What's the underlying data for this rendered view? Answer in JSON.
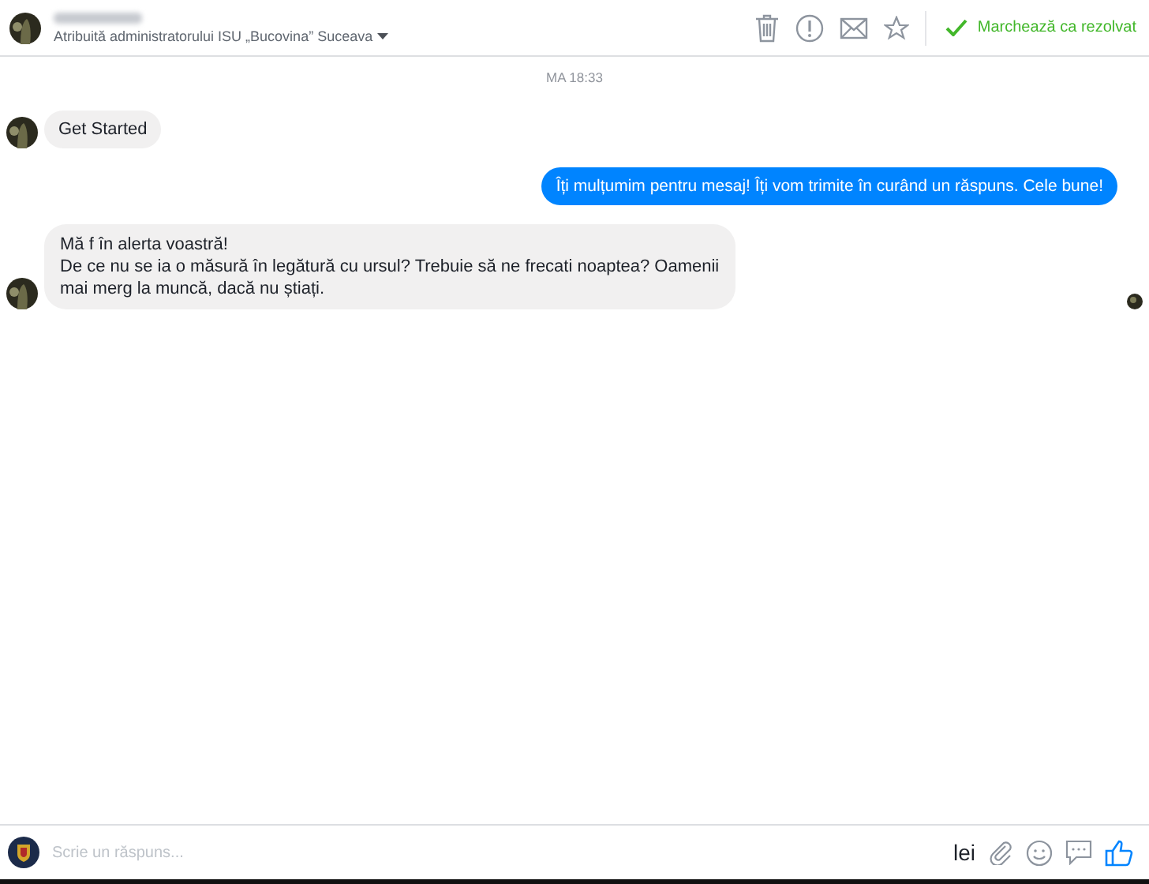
{
  "header": {
    "subtitle": "Atribuită administratorului ISU „Bucovina” Suceava",
    "resolve_label": "Marchează ca rezolvat"
  },
  "timestamp": "MA 18:33",
  "messages": [
    {
      "kind": "incoming",
      "lines": [
        "Get Started"
      ]
    },
    {
      "kind": "outgoing",
      "lines": [
        "Îți mulțumim pentru mesaj! Îți vom trimite în curând un răspuns. Cele bune!"
      ]
    },
    {
      "kind": "incoming",
      "lines": [
        "Mă f  în alerta voastră!",
        "De ce nu se ia o măsură în legătură cu ursul? Trebuie să ne frecati noaptea? Oamenii",
        "mai merg la muncă, dacă nu știați."
      ]
    }
  ],
  "composer": {
    "placeholder": "Scrie un răspuns...",
    "currency": "lei"
  }
}
